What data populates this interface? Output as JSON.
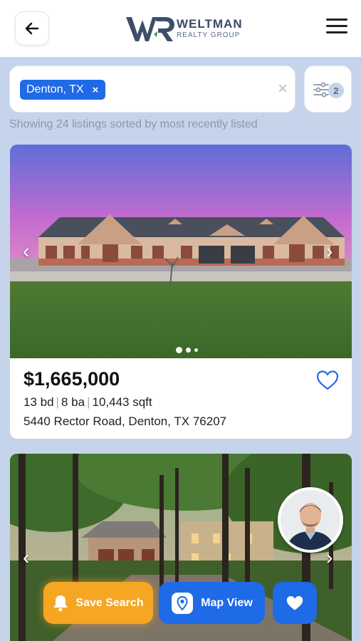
{
  "header": {
    "logo_title": "WELTMAN",
    "logo_subtitle": "REALTY GROUP",
    "icons": [
      "back-arrow-icon",
      "menu-icon"
    ]
  },
  "search": {
    "chip_label": "Denton, TX",
    "chip_close": "×",
    "clear": "×",
    "filter_count": "2"
  },
  "results": {
    "summary": "Showing 24 listings sorted by most recently listed"
  },
  "listings": [
    {
      "price": "$1,665,000",
      "beds": "13 bd",
      "baths": "8 ba",
      "sqft": "10,443 sqft",
      "address": "5440 Rector Road, Denton, TX 76207",
      "photo_index": 0,
      "photo_count": 3
    }
  ],
  "actions": {
    "save_search": "Save Search",
    "map_view": "Map View"
  },
  "colors": {
    "accent_blue": "#1f6ae6",
    "save_orange": "#f5a623",
    "page_bg": "#c5d4ea"
  }
}
